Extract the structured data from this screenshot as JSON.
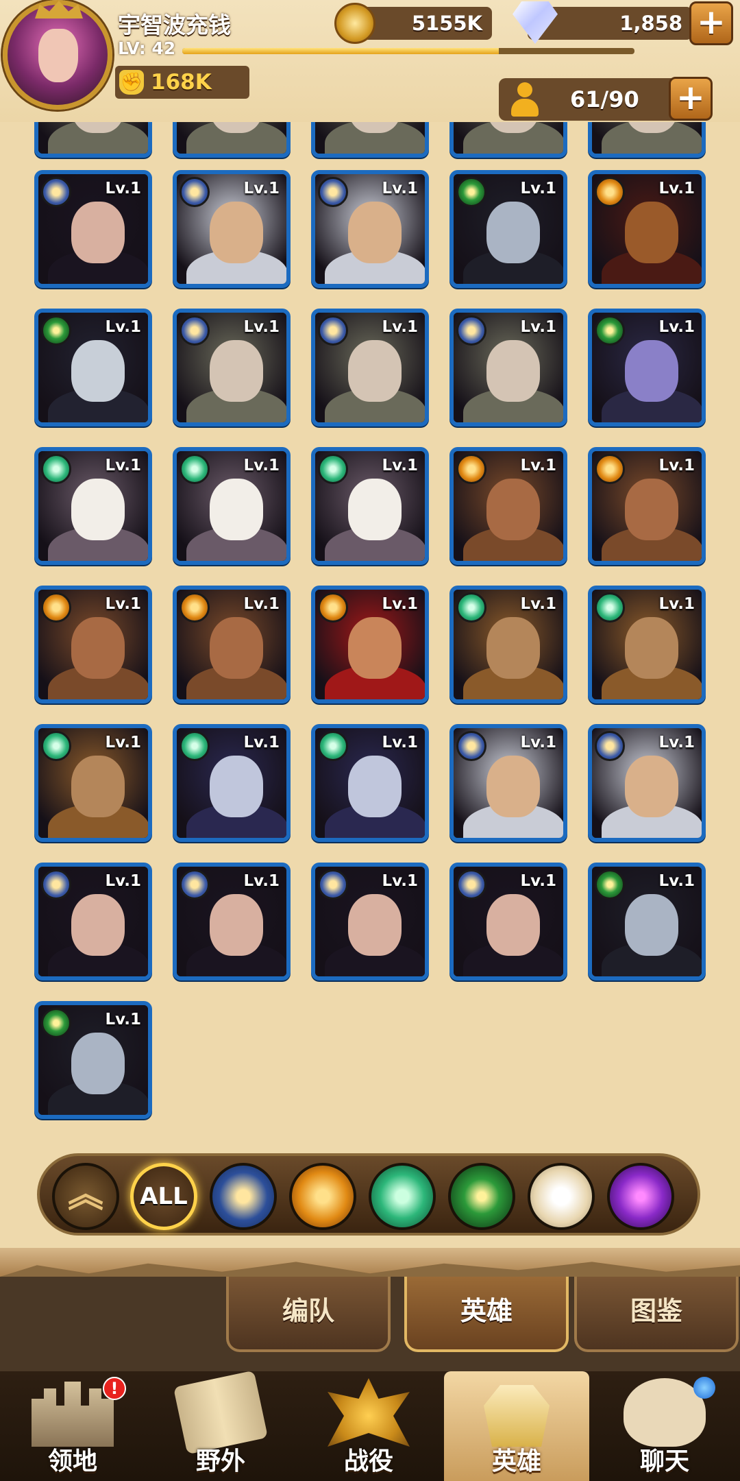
{
  "player": {
    "name": "宇智波充钱",
    "level_label": "LV: 42",
    "xp_fraction": 0.7,
    "power": "168K"
  },
  "resources": {
    "gold": "5155K",
    "gems": "1,858",
    "heroes_count": "61/90",
    "plus_label": "+"
  },
  "hero_level_label": "Lv.1",
  "heroes": [
    {
      "faction": "light",
      "look": "witch"
    },
    {
      "faction": "light",
      "look": "knight"
    },
    {
      "faction": "light",
      "look": "knight"
    },
    {
      "faction": "chaos",
      "look": "pale"
    },
    {
      "faction": "order",
      "look": "beast"
    },
    {
      "faction": "chaos",
      "look": "hood"
    },
    {
      "faction": "light",
      "look": "elder"
    },
    {
      "faction": "light",
      "look": "elder"
    },
    {
      "faction": "light",
      "look": "elder"
    },
    {
      "faction": "chaos",
      "look": "purple"
    },
    {
      "faction": "nature",
      "look": "white"
    },
    {
      "faction": "nature",
      "look": "white"
    },
    {
      "faction": "nature",
      "look": "white"
    },
    {
      "faction": "order",
      "look": "bull"
    },
    {
      "faction": "order",
      "look": "bull"
    },
    {
      "faction": "order",
      "look": "bull"
    },
    {
      "faction": "order",
      "look": "bull"
    },
    {
      "faction": "order",
      "look": "dancer"
    },
    {
      "faction": "nature",
      "look": "druid"
    },
    {
      "faction": "nature",
      "look": "druid"
    },
    {
      "faction": "nature",
      "look": "druid"
    },
    {
      "faction": "nature",
      "look": "shade"
    },
    {
      "faction": "nature",
      "look": "shade"
    },
    {
      "faction": "light",
      "look": "knight"
    },
    {
      "faction": "light",
      "look": "knight"
    },
    {
      "faction": "light",
      "look": "witch"
    },
    {
      "faction": "light",
      "look": "witch"
    },
    {
      "faction": "light",
      "look": "witch"
    },
    {
      "faction": "light",
      "look": "witch"
    },
    {
      "faction": "chaos",
      "look": "pale"
    },
    {
      "faction": "chaos",
      "look": "pale"
    }
  ],
  "filters": {
    "all_label": "ALL",
    "collapse_symbol": "︽"
  },
  "subtabs": [
    "编队",
    "英雄",
    "图鉴"
  ],
  "nav": [
    {
      "label": "领地",
      "badge": "!"
    },
    {
      "label": "野外"
    },
    {
      "label": "战役"
    },
    {
      "label": "英雄"
    },
    {
      "label": "聊天"
    }
  ],
  "colors": {
    "card_border": "#1c6bc0",
    "background": "#eed9ac",
    "accent_gold": "#ffd24a"
  }
}
